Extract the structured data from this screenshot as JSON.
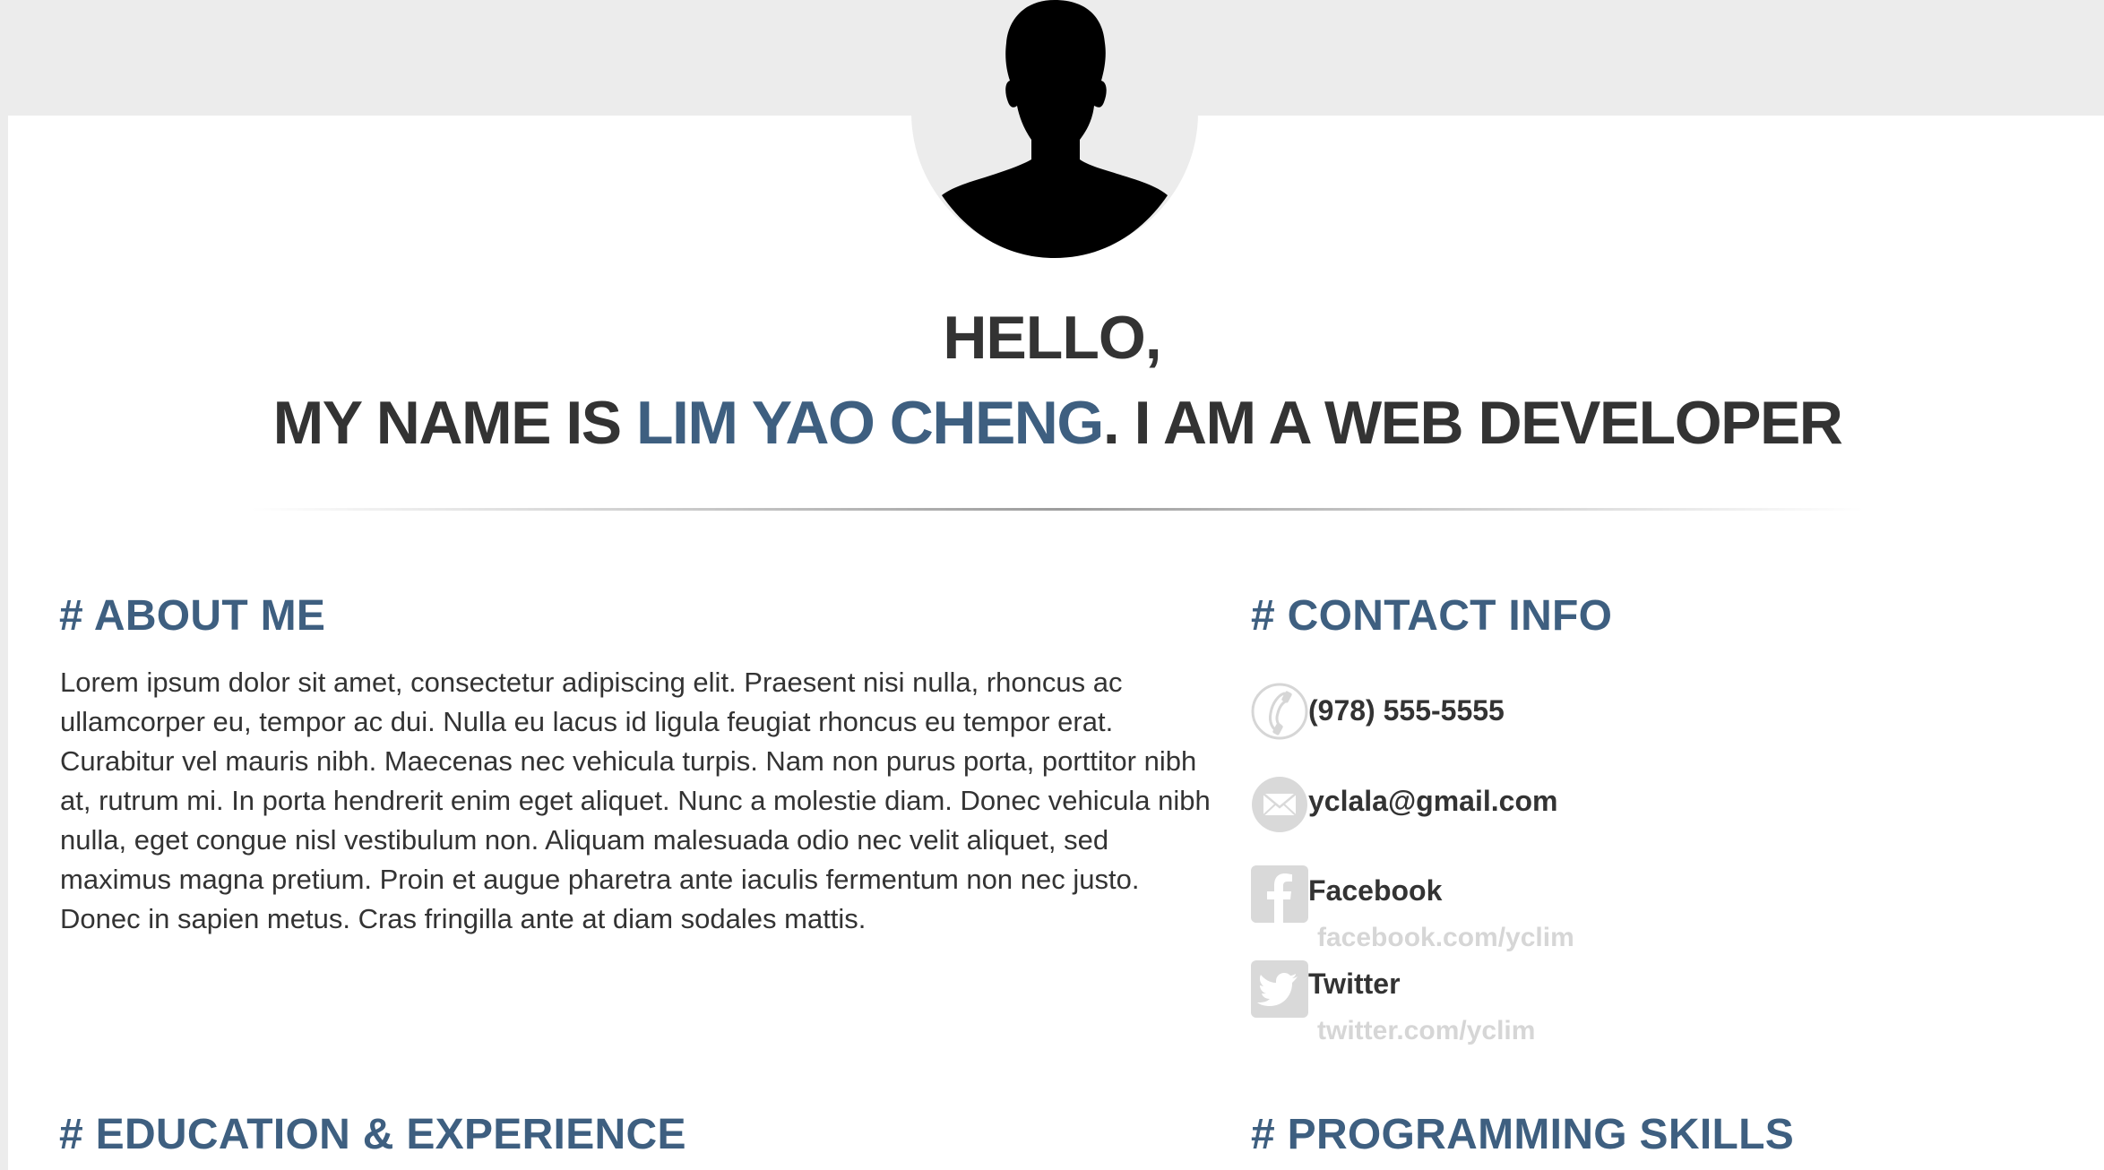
{
  "hero": {
    "greeting": "HELLO,",
    "intro_prefix": "MY NAME IS ",
    "name": "LIM YAO CHENG",
    "intro_suffix": ". I AM A WEB DEVELOPER"
  },
  "about": {
    "title": "# ABOUT ME",
    "text": "Lorem ipsum dolor sit amet, consectetur adipiscing elit. Praesent nisi nulla, rhoncus ac ullamcorper eu, tempor ac dui. Nulla eu lacus id ligula feugiat rhoncus eu tempor erat. Curabitur vel mauris nibh. Maecenas nec vehicula turpis. Nam non purus porta, porttitor nibh at, rutrum mi. In porta hendrerit enim eget aliquet. Nunc a molestie diam. Donec vehicula nibh nulla, eget congue nisl vestibulum non. Aliquam malesuada odio nec velit aliquet, sed maximus magna pretium. Proin et augue pharetra ante iaculis fermentum non nec justo. Donec in sapien metus. Cras fringilla ante at diam sodales mattis."
  },
  "contact": {
    "title": "# CONTACT INFO",
    "phone": {
      "icon": "phone-icon",
      "label": "(978) 555-5555"
    },
    "email": {
      "icon": "envelope-icon",
      "label": "yclala@gmail.com"
    },
    "facebook": {
      "icon": "facebook-icon",
      "label": "Facebook",
      "handle": "facebook.com/yclim"
    },
    "twitter": {
      "icon": "twitter-icon",
      "label": "Twitter",
      "handle": "twitter.com/yclim"
    }
  },
  "sections": {
    "education_title": "# EDUCATION & EXPERIENCE",
    "skills_title": "# PROGRAMMING SKILLS"
  },
  "colors": {
    "accent": "#3e5f80",
    "text": "#333333",
    "background": "#ececec",
    "icon_gray": "#d9d9d9"
  }
}
